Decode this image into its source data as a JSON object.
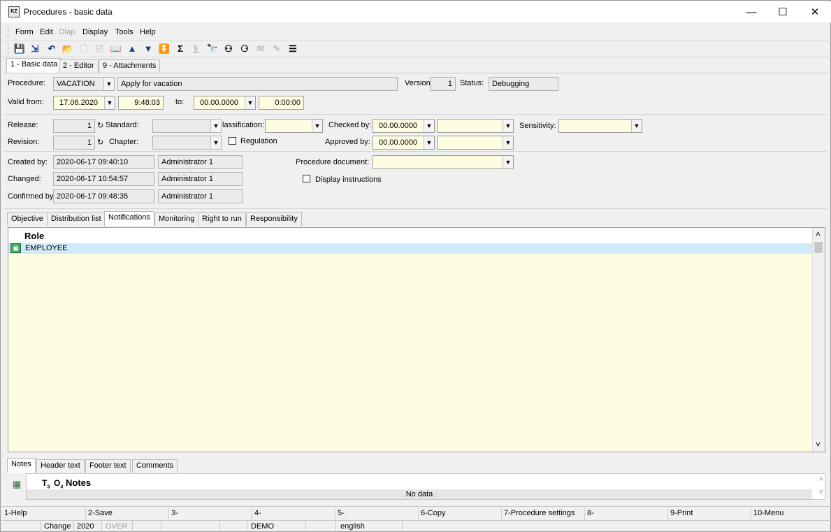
{
  "window": {
    "title": "Procedures - basic data",
    "icon_label": "KZ",
    "minimize_glyph": "—",
    "maximize_glyph": "☐",
    "close_glyph": "✕"
  },
  "menu": [
    "Form",
    "Edit",
    "Olap",
    "Display",
    "Tools",
    "Help"
  ],
  "toolbar_glyphs": {
    "save": "💾",
    "save_as": "⇲",
    "undo": "↶",
    "open": "📂",
    "new": "🗋",
    "copy": "⎘",
    "book": "📖",
    "up": "▲",
    "down": "▼",
    "filter": "⏬",
    "sum": "Σ",
    "sum_off": "⨊",
    "find": "🔭",
    "find_next": "⚇",
    "find_prev": "⚆",
    "mail": "✉",
    "edit": "✎",
    "menu": "☰"
  },
  "tabs": {
    "basic": "1 - Basic data",
    "editor": "2 - Editor",
    "attachments": "9 - Attachments"
  },
  "form": {
    "procedure_label": "Procedure:",
    "procedure_code": "VACATION",
    "procedure_name": "Apply for vacation",
    "version_label": "Version:",
    "version": "1",
    "status_label": "Status:",
    "status": "Debugging",
    "valid_from_label": "Valid from:",
    "valid_from_date": "17.06.2020",
    "valid_from_time": "9:48:03",
    "to_label": "to:",
    "to_date": "00.00.0000",
    "to_time": "0:00:00",
    "release_label": "Release:",
    "release": "1",
    "standard_label": "Standard:",
    "classification_label": "lassification:",
    "checked_by_label": "Checked by:",
    "checked_by_date": "00.00.0000",
    "sensitivity_label": "Sensitivity:",
    "revision_label": "Revision:",
    "revision": "1",
    "chapter_label": "Chapter:",
    "regulation_label": "Regulation",
    "approved_by_label": "Approved by:",
    "approved_by_date": "00.00.0000",
    "created_by_label": "Created by:",
    "created_at": "2020-06-17 09:40:10",
    "created_user": "Administrator 1",
    "changed_label": "Changed:",
    "changed_at": "2020-06-17 10:54:57",
    "changed_user": "Administrator 1",
    "confirmed_label": "Confirmed by",
    "confirmed_at": "2020-06-17 09:48:35",
    "confirmed_user": "Administrator 1",
    "procedure_document_label": "Procedure document:",
    "display_instructions_label": "Display instructions",
    "history_glyph": "↻",
    "dropdown_glyph": "▼"
  },
  "subtabs": [
    "Objective",
    "Distribution list",
    "Notifications",
    "Monitoring",
    "Right to run",
    "Responsibility"
  ],
  "notifications_grid": {
    "header": "Role",
    "rows": [
      "EMPLOYEE"
    ],
    "row_icon": "▣",
    "scroll_up": "˄",
    "scroll_down": "˅"
  },
  "bottom_tabs": [
    "Notes",
    "Header text",
    "Footer text",
    "Comments"
  ],
  "notes_grid": {
    "col_t": "T",
    "col_t_sub": "3",
    "col_o": "O",
    "col_o_sub": "4",
    "header": "Notes",
    "empty": "No data",
    "icon": "▦"
  },
  "fkeys": [
    "1-Help",
    "2-Save",
    "3-",
    "4-",
    "5-",
    "6-Copy",
    "7-Procedure settings",
    "8-",
    "9-Print",
    "10-Menu"
  ],
  "statusbar": {
    "mode": "Change",
    "year": "2020",
    "over": "OVER",
    "db": "DEMO",
    "language": "english"
  }
}
